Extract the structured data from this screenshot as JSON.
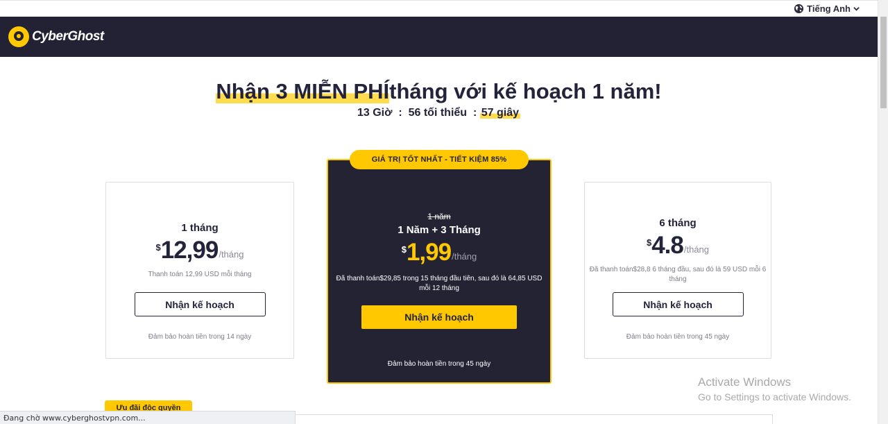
{
  "language": {
    "label": "Tiếng Anh",
    "icon": "globe-icon"
  },
  "header": {
    "logo_text": "CyberGhost"
  },
  "promo": {
    "headline_highlight": "Nhận 3 MIỄN PHÍ",
    "headline_rest": "tháng với kế hoạch 1 năm!",
    "countdown_main": "13 Giờ  :  56 tối thiểu  :",
    "countdown_seconds": "57 giây"
  },
  "plans": [
    {
      "title": "1 tháng",
      "currency": "$",
      "price": "12,99",
      "period": "/tháng",
      "billing": "Thanh toán 12,99 USD mỗi tháng",
      "button": "Nhận kế hoạch",
      "guarantee": "Đảm bảo hoàn tiền trong 14 ngày"
    },
    {
      "badge": "GIÁ TRỊ TỐT NHẤT - TIẾT KIỆM 85%",
      "old_title": "1 năm",
      "title": "1 Năm + 3 Tháng",
      "currency": "$",
      "price": "1,99",
      "period": "/tháng",
      "billing": "Đã thanh toán$29,85 trong 15 tháng đầu tiên, sau đó là 64,85 USD mỗi 12 tháng",
      "button": "Nhận kế hoạch",
      "guarantee": "Đảm bảo hoàn tiền trong 45 ngày"
    },
    {
      "title": "6 tháng",
      "currency": "$",
      "price": "4.8",
      "period": "/tháng",
      "billing": "Đã thanh toán$28,8 6 tháng đầu, sau đó là 59 USD mỗi 6 tháng",
      "button": "Nhận kế hoạch",
      "guarantee": "Đảm bảo hoàn tiền trong 45 ngày"
    }
  ],
  "exclusive_tag": "Ưu đãi độc quyền",
  "windows_watermark": {
    "line1": "Activate Windows",
    "line2": "Go to Settings to activate Windows."
  },
  "status_bar": "Đang chờ www.cyberghostvpn.com...",
  "colors": {
    "brand_yellow": "#ffc800",
    "header_bg": "#222234",
    "card_dark": "#232334"
  }
}
